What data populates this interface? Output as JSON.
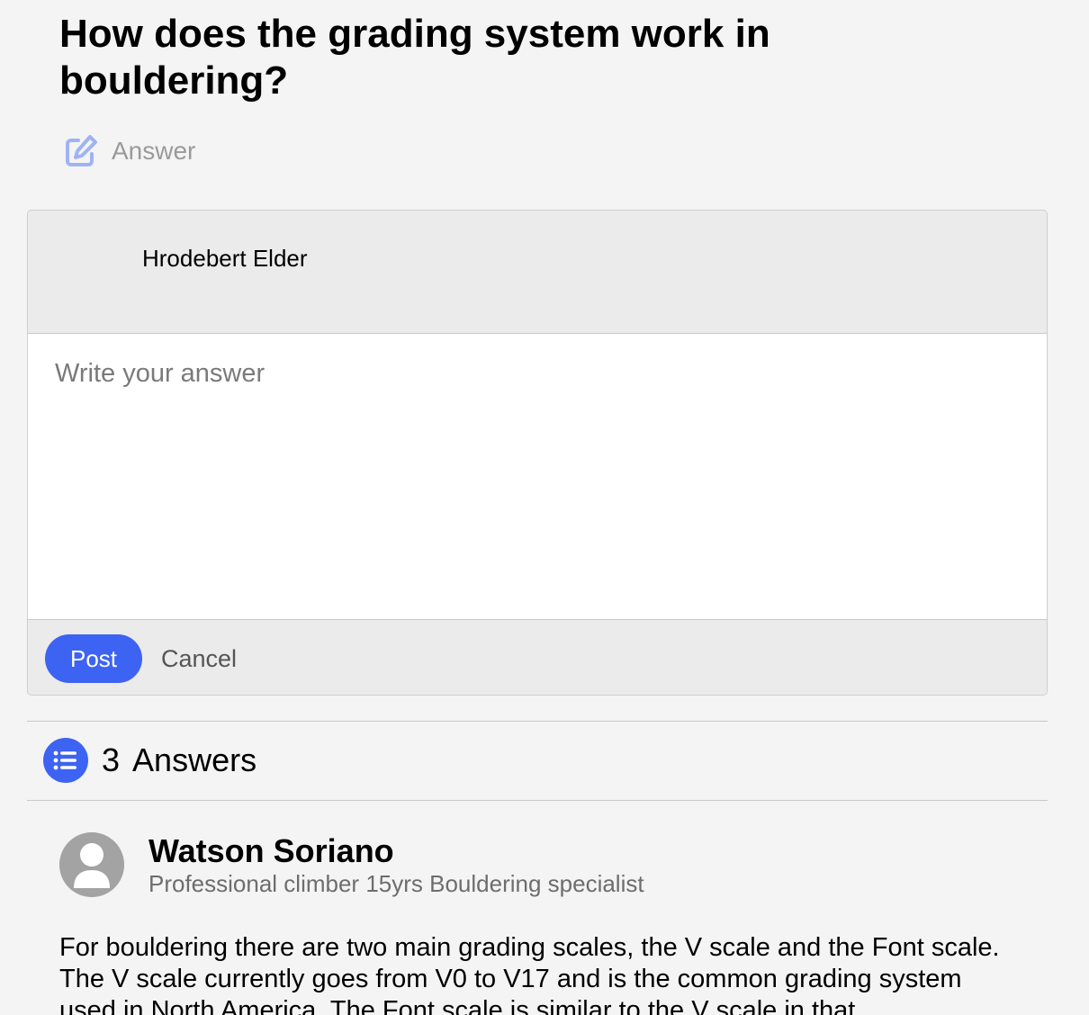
{
  "question": {
    "title": "How does the grading system work in bouldering?"
  },
  "answer_action": {
    "icon": "edit-icon",
    "label": "Answer",
    "color": "#9fb3f5"
  },
  "composer": {
    "user_name": "Hrodebert Elder",
    "placeholder": "Write your answer",
    "value": "",
    "post_label": "Post",
    "cancel_label": "Cancel"
  },
  "answers_section": {
    "icon": "list-icon",
    "count": "3",
    "label": "Answers"
  },
  "answers": [
    {
      "author": "Watson Soriano",
      "bio": "Professional climber 15yrs Bouldering specialist",
      "avatar_icon": "user-avatar-icon",
      "text": "For bouldering there are two main grading scales, the V scale and the Font scale. The V scale currently goes from V0 to V17 and is the common grading system used in North America. The Font scale is similar to the V scale in that"
    }
  ],
  "colors": {
    "accent": "#3d63f2",
    "background": "#f4f4f4"
  }
}
